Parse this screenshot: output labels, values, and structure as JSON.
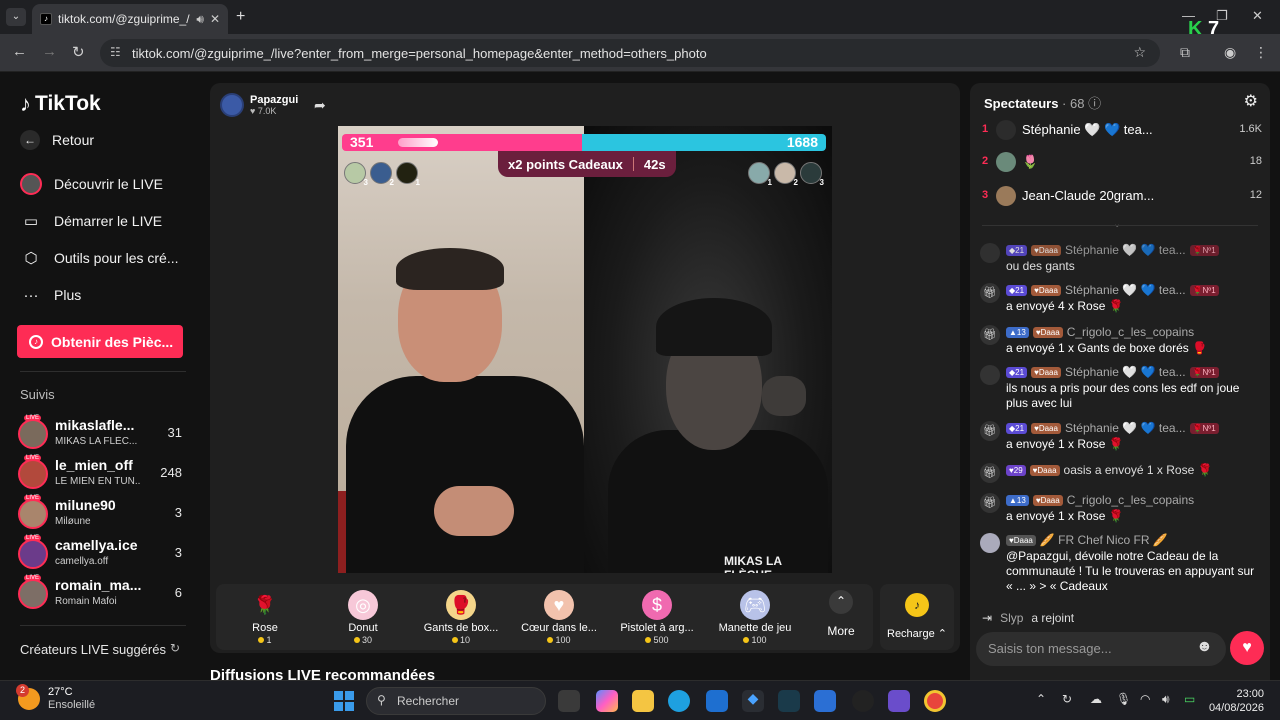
{
  "browser": {
    "tab_title": "tiktok.com/@zguiprime_/liv",
    "url": "tiktok.com/@zguiprime_/live?enter_from_merge=personal_homepage&enter_method=others_photo",
    "overlay_logo_k": "K",
    "overlay_logo_num": "7"
  },
  "sidebar": {
    "logo": "TikTok",
    "back": "Retour",
    "nav": [
      {
        "label": "Découvrir le LIVE",
        "icon": "avatar-live-icon"
      },
      {
        "label": "Démarrer le LIVE",
        "icon": "video-camera-icon"
      },
      {
        "label": "Outils pour les cré...",
        "icon": "creator-tools-icon"
      },
      {
        "label": "Plus",
        "icon": "more-dots-icon"
      }
    ],
    "coins_button": "Obtenir des Pièc...",
    "following_title": "Suivis",
    "live_badge": "LIVE",
    "following": [
      {
        "name": "mikaslafle...",
        "sub": "MIKAS LA FLÈC...",
        "count": "31"
      },
      {
        "name": "le_mien_off",
        "sub": "LE MIEN EN TUN...",
        "count": "248"
      },
      {
        "name": "milune90",
        "sub": "Miløune",
        "count": "3"
      },
      {
        "name": "camellya.ice",
        "sub": "camellya.off",
        "count": "3"
      },
      {
        "name": "romain_ma...",
        "sub": "Romain Mafoi",
        "count": "6"
      }
    ],
    "suggested_title": "Créateurs LIVE suggérés"
  },
  "stream": {
    "host_name": "Papazgui",
    "host_likes": "7.0K",
    "score_left": "351",
    "score_right": "1688",
    "bonus_label": "x2 points Cadeaux",
    "timer": "42s",
    "participants_left": [
      "3",
      "2",
      "1"
    ],
    "participants_right": [
      "1",
      "2",
      "3"
    ],
    "right_streamer_name": "MIKAS LA FLÈCHE"
  },
  "gifts": [
    {
      "name": "Rose",
      "price": "1",
      "icon": "rose-icon"
    },
    {
      "name": "Donut",
      "price": "30",
      "icon": "donut-icon"
    },
    {
      "name": "Gants de box...",
      "price": "10",
      "icon": "boxing-gloves-icon"
    },
    {
      "name": "Cœur dans le...",
      "price": "100",
      "icon": "heart-hands-icon"
    },
    {
      "name": "Pistolet à arg...",
      "price": "500",
      "icon": "money-gun-icon"
    },
    {
      "name": "Manette de jeu",
      "price": "100",
      "icon": "gamepad-icon"
    }
  ],
  "gift_more": "More",
  "recharge": "Recharge",
  "recommended_title": "Diffusions LIVE recommandées",
  "viewers": {
    "title": "Spectateurs",
    "count": "· 68",
    "list": [
      {
        "rank": "1",
        "name": "Stéphanie 🤍 💙 tea...",
        "score": "1.6K"
      },
      {
        "rank": "2",
        "name": "🌷",
        "score": "18"
      },
      {
        "rank": "3",
        "name": "Jean-Claude 20gram...",
        "score": "12"
      }
    ]
  },
  "chat": [
    {
      "level": "21",
      "fan": "Daaa",
      "user": "Stéphanie 🤍 💙 tea...",
      "rank": "Nº1",
      "text": "ou des gants"
    },
    {
      "level": "21",
      "fan": "Daaa",
      "user": "Stéphanie 🤍 💙 tea...",
      "rank": "Nº1",
      "text": "a envoyé 4 x Rose 🌹"
    },
    {
      "level": "13",
      "fan": "Daaa",
      "user": "C_rigolo_c_les_copains",
      "rank": "",
      "text": "a envoyé 1 x Gants de boxe dorés 🥊"
    },
    {
      "level": "21",
      "fan": "Daaa",
      "user": "Stéphanie 🤍 💙 tea...",
      "rank": "Nº1",
      "text": "ils nous a pris pour des cons les edf on joue plus avec lui"
    },
    {
      "level": "21",
      "fan": "Daaa",
      "user": "Stéphanie 🤍 💙 tea...",
      "rank": "Nº1",
      "text": "a envoyé 1 x Rose 🌹"
    },
    {
      "level": "29",
      "fan": "Daaa",
      "user": "oasis a envoyé 1 x Rose 🌹",
      "rank": "",
      "text": ""
    },
    {
      "level": "13",
      "fan": "Daaa",
      "user": "C_rigolo_c_les_copains",
      "rank": "",
      "text": "a envoyé 1 x Rose 🌹"
    }
  ],
  "community": {
    "fan": "Daaa",
    "user": "🥖 FR Chef Nico FR 🥖",
    "text": "@Papazgui, dévoile notre Cadeau de la communauté ! Tu le trouveras en appuyant sur « ... » > « Cadeaux"
  },
  "joined": {
    "user": "Slyp",
    "action": "a rejoint"
  },
  "chat_placeholder": "Saisis ton message...",
  "taskbar": {
    "temp": "27°C",
    "weather": "Ensoleillé",
    "notif": "2",
    "search": "Rechercher",
    "time": "23:00",
    "date": "04/08/2026"
  }
}
